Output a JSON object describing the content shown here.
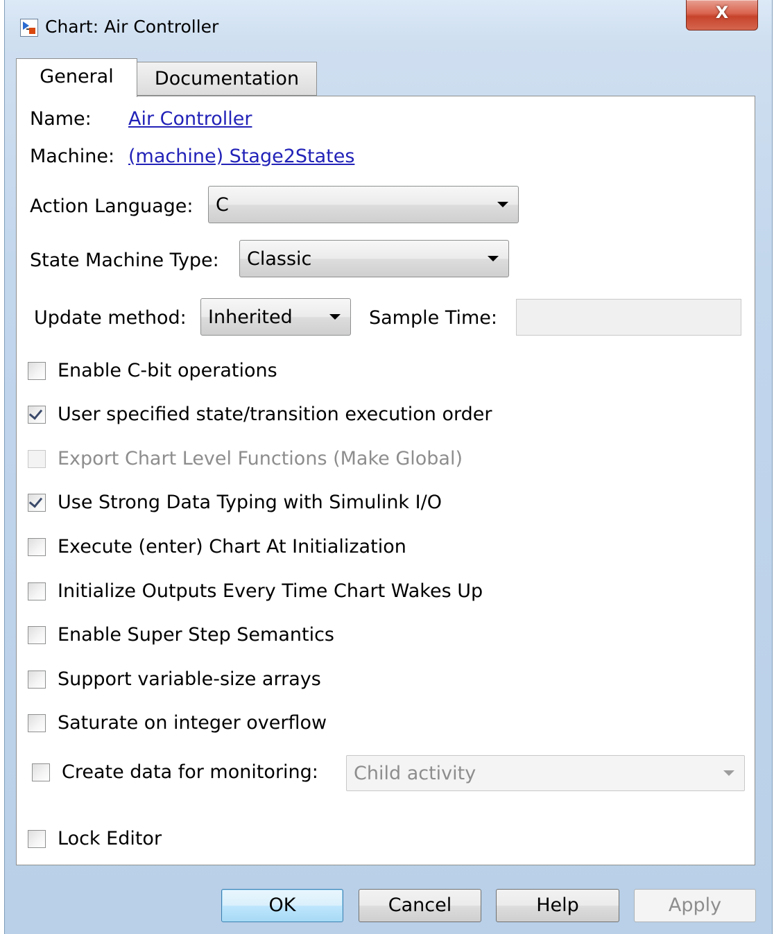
{
  "window": {
    "title": "Chart: Air Controller",
    "close_label": "X"
  },
  "tabs": [
    {
      "label": "General",
      "active": true
    },
    {
      "label": "Documentation",
      "active": false
    }
  ],
  "general": {
    "name_label": "Name:",
    "name_value": "Air Controller",
    "machine_label": "Machine:",
    "machine_value": "(machine) Stage2States",
    "action_language": {
      "label": "Action Language:",
      "value": "C"
    },
    "state_machine_type": {
      "label": "State Machine Type:",
      "value": "Classic"
    },
    "update_method": {
      "label": "Update method:",
      "value": "Inherited"
    },
    "sample_time": {
      "label": "Sample Time:",
      "value": ""
    },
    "checkboxes": [
      {
        "label": "Enable C-bit operations",
        "checked": false,
        "enabled": true
      },
      {
        "label": "User specified state/transition execution order",
        "checked": true,
        "enabled": true
      },
      {
        "label": "Export Chart Level Functions (Make Global)",
        "checked": false,
        "enabled": false
      },
      {
        "label": "Use Strong Data Typing with Simulink I/O",
        "checked": true,
        "enabled": true
      },
      {
        "label": "Execute (enter) Chart At Initialization",
        "checked": false,
        "enabled": true
      },
      {
        "label": "Initialize Outputs Every Time Chart Wakes Up",
        "checked": false,
        "enabled": true
      },
      {
        "label": "Enable Super Step Semantics",
        "checked": false,
        "enabled": true
      },
      {
        "label": "Support variable-size arrays",
        "checked": false,
        "enabled": true
      },
      {
        "label": "Saturate on integer overflow",
        "checked": false,
        "enabled": true
      }
    ],
    "monitoring": {
      "label": "Create data for monitoring:",
      "checked": false,
      "value": "Child activity"
    },
    "lock_editor": {
      "label": "Lock Editor",
      "checked": false
    }
  },
  "buttons": {
    "ok": "OK",
    "cancel": "Cancel",
    "help": "Help",
    "apply": "Apply"
  }
}
